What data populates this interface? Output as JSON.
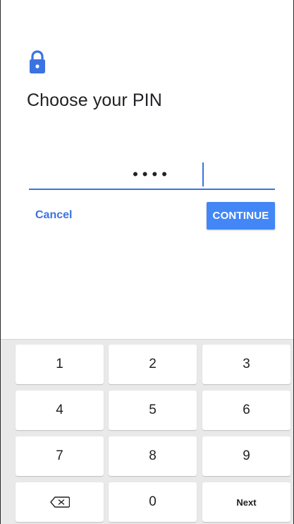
{
  "header": {
    "lock_icon": "lock-icon",
    "title": "Choose your PIN"
  },
  "pin_field": {
    "value": "••••",
    "accent_color": "#3b73e0"
  },
  "actions": {
    "cancel_label": "Cancel",
    "continue_label": "CONTINUE",
    "continue_color": "#4287f5"
  },
  "keypad": {
    "keys": [
      "1",
      "2",
      "3",
      "4",
      "5",
      "6",
      "7",
      "8",
      "9",
      "",
      "0",
      "Next"
    ],
    "backspace_icon": "backspace-icon"
  }
}
